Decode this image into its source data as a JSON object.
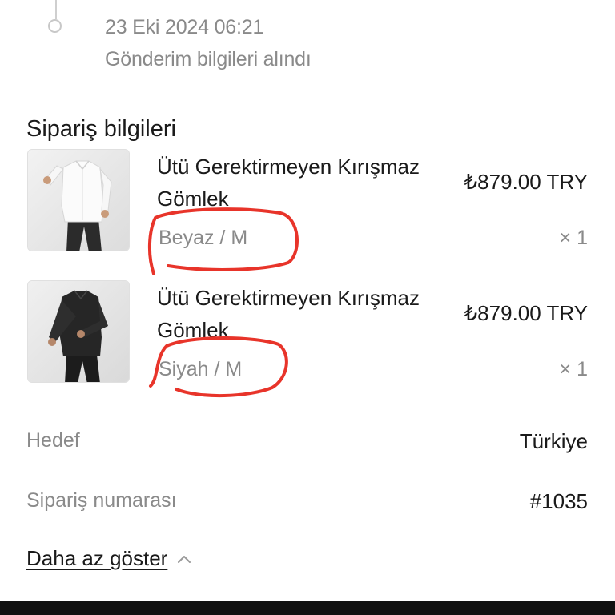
{
  "timeline": {
    "date": "23 Eki 2024 06:21",
    "description": "Gönderim bilgileri alındı"
  },
  "order_info": {
    "title": "Sipariş bilgileri",
    "items": [
      {
        "name": "Ütü Gerektirmeyen Kırışmaz Gömlek",
        "variant": "Beyaz / M",
        "price": "₺879.00 TRY",
        "quantity": "× 1",
        "image": "white-shirt-photo"
      },
      {
        "name": "Ütü Gerektirmeyen Kırışmaz Gömlek",
        "variant": "Siyah / M",
        "price": "₺879.00 TRY",
        "quantity": "× 1",
        "image": "black-shirt-photo"
      }
    ],
    "destination_label": "Hedef",
    "destination_value": "Türkiye",
    "order_number_label": "Sipariş numarası",
    "order_number_value": "#1035"
  },
  "actions": {
    "show_less": "Daha az göster",
    "show_less_icon": "chevron-up-icon"
  },
  "colors": {
    "annotation": "#e8342a",
    "muted_text": "#8a8a8a",
    "primary_text": "#1a1a1a"
  }
}
